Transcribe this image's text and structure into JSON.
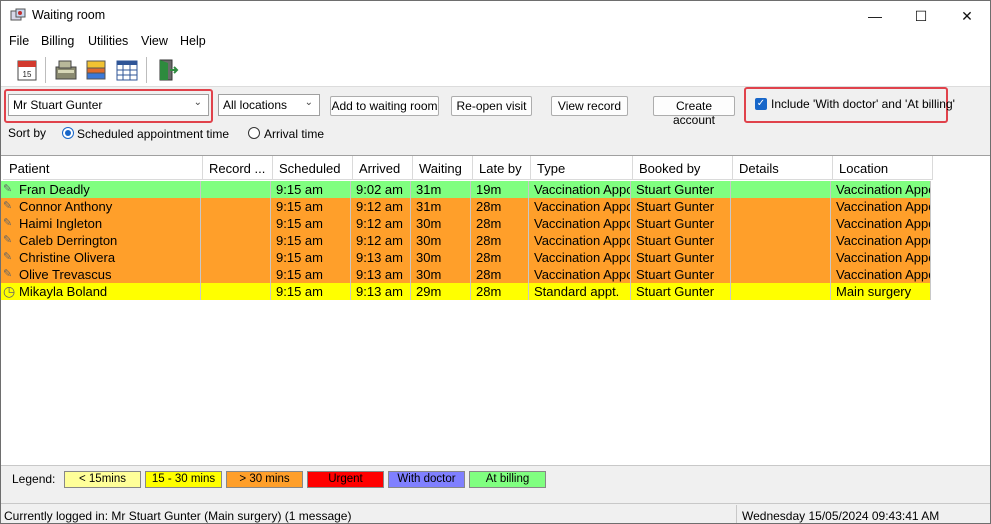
{
  "window": {
    "title": "Waiting room",
    "controls": {
      "minimize": "—",
      "maximize": "☐",
      "close": "✕"
    }
  },
  "menu": [
    "File",
    "Billing",
    "Utilities",
    "View",
    "Help"
  ],
  "toolbar": {
    "buttons": [
      "calendar-icon",
      "cash-register-icon",
      "cards-icon",
      "schedule-grid-icon",
      "exit-door-icon"
    ]
  },
  "controls": {
    "practitioner": "Mr Stuart Gunter",
    "location": "All locations",
    "add_btn": "Add to waiting room",
    "reopen_btn": "Re-open visit",
    "view_btn": "View record",
    "account_btn": "Create account",
    "include_label": "Include 'With doctor' and 'At billing'",
    "include_checked": true,
    "sort_label": "Sort by",
    "sort_options": [
      "Scheduled appointment time",
      "Arrival time"
    ],
    "sort_selected": "Scheduled appointment time"
  },
  "table": {
    "columns": [
      "Patient",
      "Record ...",
      "Scheduled",
      "Arrived",
      "Waiting",
      "Late by",
      "Type",
      "Booked by",
      "Details",
      "Location"
    ],
    "rows": [
      {
        "patient": "Fran Deadly",
        "record": "",
        "scheduled": "9:15 am",
        "arrived": "9:02 am",
        "waiting": "31m",
        "late": "19m",
        "type": "Vaccination Appo",
        "booked": "Stuart Gunter",
        "details": "",
        "location": "Vaccination Appo",
        "color": "#80ff80",
        "icon": "paper"
      },
      {
        "patient": "Connor Anthony",
        "record": "",
        "scheduled": "9:15 am",
        "arrived": "9:12 am",
        "waiting": "31m",
        "late": "28m",
        "type": "Vaccination Appo",
        "booked": "Stuart Gunter",
        "details": "",
        "location": "Vaccination Appo",
        "color": "#ff9f2a",
        "icon": "paper"
      },
      {
        "patient": "Haimi Ingleton",
        "record": "",
        "scheduled": "9:15 am",
        "arrived": "9:12 am",
        "waiting": "30m",
        "late": "28m",
        "type": "Vaccination Appo",
        "booked": "Stuart Gunter",
        "details": "",
        "location": "Vaccination Appo",
        "color": "#ff9f2a",
        "icon": "paper"
      },
      {
        "patient": "Caleb Derrington",
        "record": "",
        "scheduled": "9:15 am",
        "arrived": "9:12 am",
        "waiting": "30m",
        "late": "28m",
        "type": "Vaccination Appo",
        "booked": "Stuart Gunter",
        "details": "",
        "location": "Vaccination Appo",
        "color": "#ff9f2a",
        "icon": "paper"
      },
      {
        "patient": "Christine Olivera",
        "record": "",
        "scheduled": "9:15 am",
        "arrived": "9:13 am",
        "waiting": "30m",
        "late": "28m",
        "type": "Vaccination Appo",
        "booked": "Stuart Gunter",
        "details": "",
        "location": "Vaccination Appo",
        "color": "#ff9f2a",
        "icon": "paper"
      },
      {
        "patient": "Olive Trevascus",
        "record": "",
        "scheduled": "9:15 am",
        "arrived": "9:13 am",
        "waiting": "30m",
        "late": "28m",
        "type": "Vaccination Appo",
        "booked": "Stuart Gunter",
        "details": "",
        "location": "Vaccination Appo",
        "color": "#ff9f2a",
        "icon": "paper"
      },
      {
        "patient": "Mikayla Boland",
        "record": "",
        "scheduled": "9:15 am",
        "arrived": "9:13 am",
        "waiting": "29m",
        "late": "28m",
        "type": "Standard appt.",
        "booked": "Stuart Gunter",
        "details": "",
        "location": "Main surgery",
        "color": "#ffff00",
        "icon": "clock"
      }
    ]
  },
  "legend": {
    "label": "Legend:",
    "items": [
      {
        "text": "< 15mins",
        "bg": "#ffff99",
        "fg": "#000000"
      },
      {
        "text": "15 - 30 mins",
        "bg": "#ffff00",
        "fg": "#000000"
      },
      {
        "text": "> 30 mins",
        "bg": "#ff9f2a",
        "fg": "#000000"
      },
      {
        "text": "Urgent",
        "bg": "#ff0000",
        "fg": "#000000"
      },
      {
        "text": "With doctor",
        "bg": "#8080ff",
        "fg": "#000000"
      },
      {
        "text": "At billing",
        "bg": "#80ff80",
        "fg": "#000000"
      }
    ]
  },
  "status": {
    "left": "Currently logged in:  Mr Stuart Gunter (Main surgery) (1 message)",
    "right": "Wednesday 15/05/2024 09:43:41 AM"
  }
}
